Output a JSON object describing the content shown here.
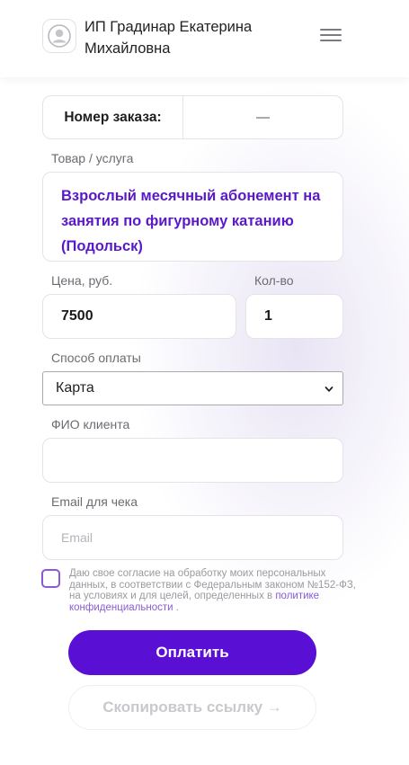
{
  "header": {
    "seller_name": "ИП Градинар Екатерина Михайловна",
    "avatar_icon": "user-avatar-icon",
    "menu_icon": "hamburger-menu-icon"
  },
  "order": {
    "label": "Номер заказа:",
    "value": "—"
  },
  "product": {
    "label": "Товар / услуга",
    "value": "Взрослый месячный абонемент на занятия по фигурному катанию (Подольск)"
  },
  "price": {
    "label": "Цена, руб.",
    "value": "7500"
  },
  "quantity": {
    "label": "Кол-во",
    "value": "1"
  },
  "payment_method": {
    "label": "Способ оплаты",
    "selected": "Карта"
  },
  "client_name": {
    "label": "ФИО клиента",
    "value": ""
  },
  "email": {
    "label": "Email для чека",
    "placeholder": "Email"
  },
  "consent": {
    "text": "Даю свое согласие на обработку моих персональных данных, в соответствии с Федеральным законом №152-ФЗ, на условиях и для целей, определенных в",
    "link": "политике конфиденциальности",
    "suffix": "."
  },
  "buttons": {
    "pay": "Оплатить",
    "copy_link": "Скопировать ссылку →"
  },
  "colors": {
    "accent": "#5a0fd4",
    "product_text": "#5a19c9",
    "checkbox_border": "#8a5bd6"
  }
}
